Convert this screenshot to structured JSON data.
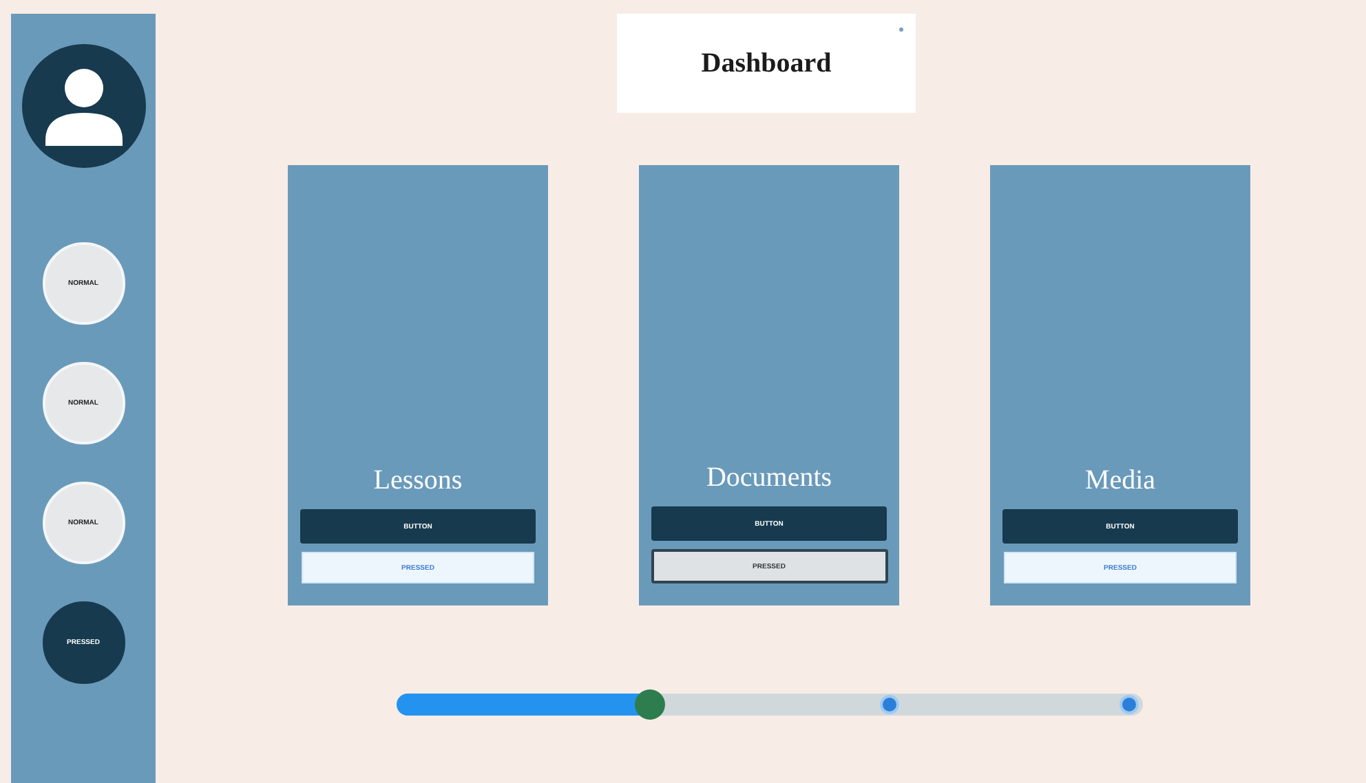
{
  "sidebar": {
    "items": [
      {
        "label": "NORMAL",
        "selected": false
      },
      {
        "label": "NORMAL",
        "selected": false
      },
      {
        "label": "NORMAL",
        "selected": false
      },
      {
        "label": "PRESSED",
        "selected": true
      }
    ]
  },
  "header": {
    "title": "Dashboard"
  },
  "cards": [
    {
      "title": "Lessons",
      "button": "BUTTON",
      "pressed_button": "PRESSED",
      "selected": false
    },
    {
      "title": "Documents",
      "button": "BUTTON",
      "pressed_button": "PRESSED",
      "selected": true
    },
    {
      "title": "Media",
      "button": "BUTTON",
      "pressed_button": "PRESSED",
      "selected": false
    }
  ],
  "slider": {
    "level": 0.34
  }
}
